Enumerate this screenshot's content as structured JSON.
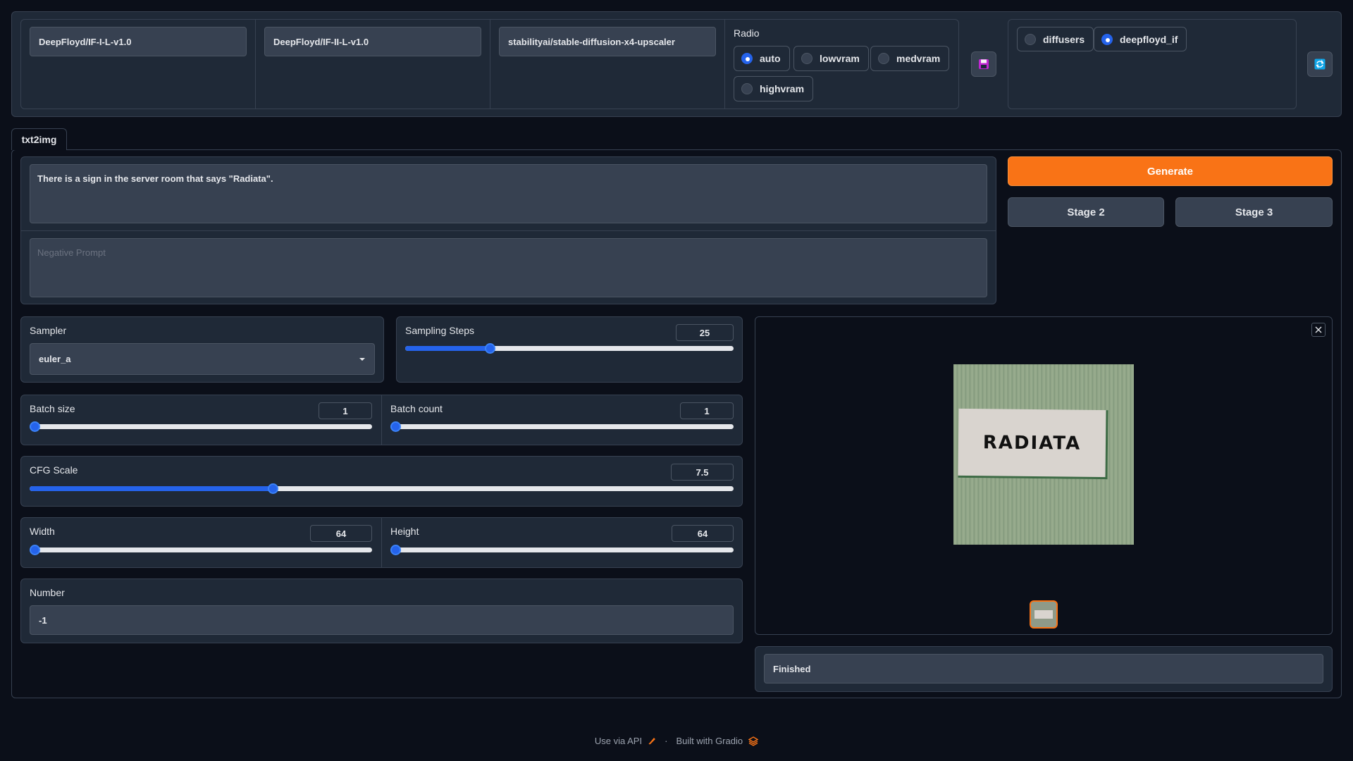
{
  "models": {
    "stage1": "DeepFloyd/IF-I-L-v1.0",
    "stage2": "DeepFloyd/IF-II-L-v1.0",
    "stage3": "stabilityai/stable-diffusion-x4-upscaler"
  },
  "radio": {
    "label": "Radio",
    "options": [
      "auto",
      "lowvram",
      "medvram",
      "highvram"
    ],
    "selected": "auto"
  },
  "mode": {
    "options": [
      "diffusers",
      "deepfloyd_if"
    ],
    "selected": "deepfloyd_if"
  },
  "tabs": {
    "txt2img": "txt2img"
  },
  "prompt": {
    "value": "There is a sign in the server room that says \"Radiata\".",
    "negative_placeholder": "Negative Prompt"
  },
  "actions": {
    "generate": "Generate",
    "stage2": "Stage 2",
    "stage3": "Stage 3"
  },
  "sampler": {
    "label": "Sampler",
    "value": "euler_a"
  },
  "sampling_steps": {
    "label": "Sampling Steps",
    "value": "25",
    "fraction": 0.25
  },
  "batch_size": {
    "label": "Batch size",
    "value": "1",
    "fraction": 0
  },
  "batch_count": {
    "label": "Batch count",
    "value": "1",
    "fraction": 0
  },
  "cfg_scale": {
    "label": "CFG Scale",
    "value": "7.5",
    "fraction": 0.344
  },
  "width": {
    "label": "Width",
    "value": "64",
    "fraction": 0
  },
  "height": {
    "label": "Height",
    "value": "64",
    "fraction": 0
  },
  "seed": {
    "label": "Number",
    "value": "-1"
  },
  "output": {
    "image_text": "RADIATA",
    "status": "Finished"
  },
  "footer": {
    "api": "Use via API",
    "separator": "·",
    "built": "Built with Gradio"
  },
  "colors": {
    "accent": "#f97316",
    "slider": "#2563eb",
    "background": "#0b0f19"
  }
}
